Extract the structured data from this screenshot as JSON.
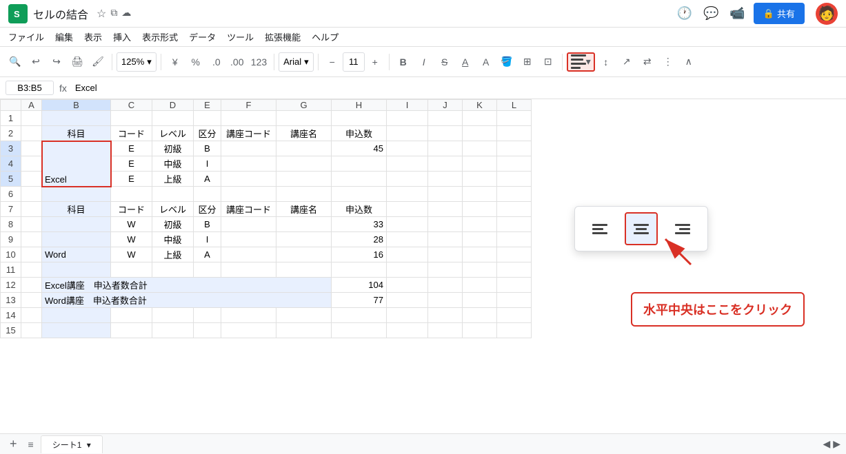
{
  "app": {
    "icon": "Σ",
    "title": "セルの結合",
    "share_label": "共有"
  },
  "menu": {
    "items": [
      "ファイル",
      "編集",
      "表示",
      "挿入",
      "表示形式",
      "データ",
      "ツール",
      "拡張機能",
      "ヘルプ"
    ]
  },
  "toolbar": {
    "zoom": "125%",
    "currency": "¥",
    "percent": "%",
    "decimal_0": ".0",
    "decimal_00": ".00",
    "num_format": "123",
    "font": "Arial",
    "font_size": "11"
  },
  "formula_bar": {
    "cell_ref": "B3:B5",
    "fx": "fx",
    "formula": "Excel"
  },
  "spreadsheet": {
    "col_headers": [
      "",
      "A",
      "B",
      "C",
      "D",
      "E",
      "F",
      "G",
      "H",
      "I",
      "J",
      "K",
      "L"
    ],
    "rows": [
      {
        "row": "1",
        "cells": [
          "",
          "",
          "",
          "",
          "",
          "",
          "",
          "",
          "",
          "",
          "",
          ""
        ]
      },
      {
        "row": "2",
        "cells": [
          "",
          "科目",
          "コード",
          "レベル",
          "区分",
          "講座コード",
          "講座名",
          "申込数",
          "",
          "",
          "",
          ""
        ]
      },
      {
        "row": "3",
        "cells": [
          "",
          "",
          "E",
          "初級",
          "B",
          "",
          "",
          "45",
          "",
          "",
          "",
          ""
        ]
      },
      {
        "row": "4",
        "cells": [
          "",
          "",
          "E",
          "中級",
          "I",
          "",
          "",
          "",
          "",
          "",
          "",
          ""
        ]
      },
      {
        "row": "5",
        "cells": [
          "",
          "Excel",
          "E",
          "上級",
          "A",
          "",
          "",
          "",
          "",
          "",
          "",
          ""
        ]
      },
      {
        "row": "6",
        "cells": [
          "",
          "",
          "",
          "",
          "",
          "",
          "",
          "",
          "",
          "",
          "",
          ""
        ]
      },
      {
        "row": "7",
        "cells": [
          "",
          "科目",
          "コード",
          "レベル",
          "区分",
          "講座コード",
          "講座名",
          "申込数",
          "",
          "",
          "",
          ""
        ]
      },
      {
        "row": "8",
        "cells": [
          "",
          "",
          "W",
          "初級",
          "B",
          "",
          "",
          "33",
          "",
          "",
          "",
          ""
        ]
      },
      {
        "row": "9",
        "cells": [
          "",
          "",
          "W",
          "中級",
          "I",
          "",
          "",
          "28",
          "",
          "",
          "",
          ""
        ]
      },
      {
        "row": "10",
        "cells": [
          "",
          "Word",
          "W",
          "上級",
          "A",
          "",
          "",
          "16",
          "",
          "",
          "",
          ""
        ]
      },
      {
        "row": "11",
        "cells": [
          "",
          "",
          "",
          "",
          "",
          "",
          "",
          "",
          "",
          "",
          "",
          ""
        ]
      },
      {
        "row": "12",
        "cells": [
          "",
          "Excel講座　申込者数合計",
          "",
          "",
          "",
          "",
          "",
          "104",
          "",
          "",
          "",
          ""
        ]
      },
      {
        "row": "13",
        "cells": [
          "",
          "Word講座　申込者数合計",
          "",
          "",
          "",
          "",
          "",
          "77",
          "",
          "",
          "",
          ""
        ]
      },
      {
        "row": "14",
        "cells": [
          "",
          "",
          "",
          "",
          "",
          "",
          "",
          "",
          "",
          "",
          "",
          ""
        ]
      },
      {
        "row": "15",
        "cells": [
          "",
          "",
          "",
          "",
          "",
          "",
          "",
          "",
          "",
          "",
          "",
          ""
        ]
      }
    ]
  },
  "tab_bar": {
    "sheet_name": "シート1"
  },
  "align_popup": {
    "options": [
      "left",
      "center",
      "right"
    ]
  },
  "callout": {
    "text": "水平中央はここをクリック"
  }
}
